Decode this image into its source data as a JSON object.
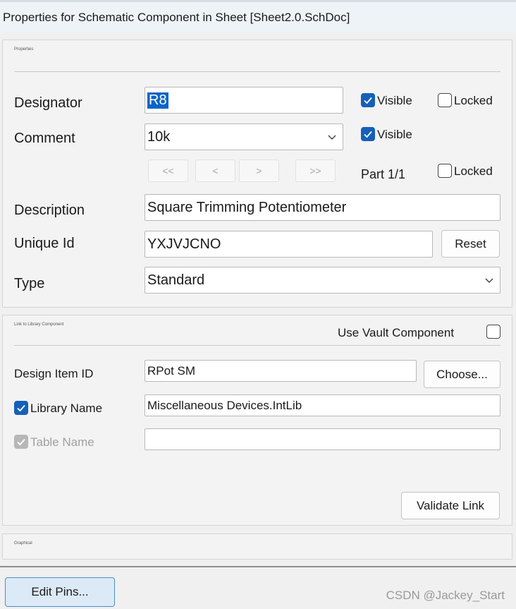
{
  "window": {
    "title": "Properties for Schematic Component in Sheet [Sheet2.0.SchDoc]"
  },
  "properties": {
    "group_title": "Properties",
    "designator": {
      "label": "Designator",
      "value": "R8",
      "visible_label": "Visible",
      "visible_checked": true,
      "locked_label": "Locked",
      "locked_checked": false
    },
    "comment": {
      "label": "Comment",
      "value": "10k",
      "visible_label": "Visible",
      "visible_checked": true
    },
    "part_nav": {
      "first": "<<",
      "prev": "<",
      "next": ">",
      "last": ">>",
      "part_label": "Part 1/1",
      "locked_label": "Locked",
      "locked_checked": false
    },
    "description": {
      "label": "Description",
      "value": "Square Trimming Potentiometer"
    },
    "unique_id": {
      "label": "Unique Id",
      "value": "YXJVJCNO",
      "reset_label": "Reset"
    },
    "type": {
      "label": "Type",
      "value": "Standard"
    }
  },
  "library_link": {
    "group_title": "Link to Library Component",
    "use_vault_label": "Use Vault Component",
    "use_vault_checked": false,
    "design_item_id": {
      "label": "Design Item ID",
      "value": "RPot SM",
      "choose_label": "Choose..."
    },
    "library_name": {
      "label": "Library Name",
      "checked": true,
      "value": "Miscellaneous Devices.IntLib"
    },
    "table_name": {
      "label": "Table Name",
      "checked": true,
      "disabled": true,
      "value": ""
    },
    "validate_label": "Validate Link"
  },
  "graphical": {
    "group_title": "Graphical"
  },
  "footer": {
    "edit_pins_label": "Edit Pins...",
    "watermark": "CSDN @Jackey_Start"
  },
  "colors": {
    "accent": "#1560b8",
    "selection": "#0a64c8",
    "disabled": "#b7b7b7"
  }
}
